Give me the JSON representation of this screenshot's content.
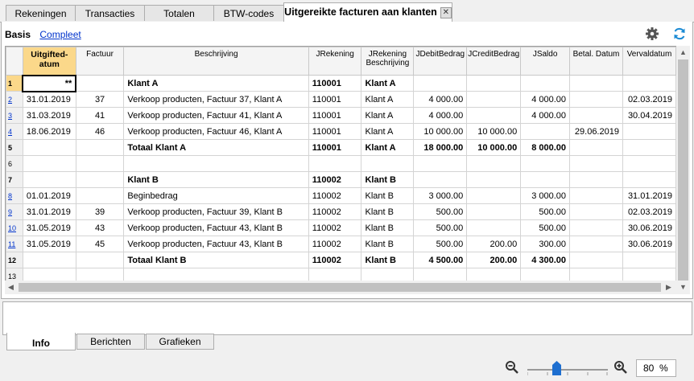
{
  "tabs": [
    {
      "label": "Rekeningen"
    },
    {
      "label": "Transacties"
    },
    {
      "label": "Totalen"
    },
    {
      "label": "BTW-codes"
    },
    {
      "label": "Uitgereikte facturen aan klanten"
    }
  ],
  "close_glyph": "✕",
  "views": {
    "basis": "Basis",
    "compleet": "Compleet"
  },
  "columns": {
    "date": "Uitgifted-atum",
    "factuur": "Factuur",
    "beschrijving": "Beschrijving",
    "jrekening": "JRekening",
    "jrekening_beschrijving": "JRekening Beschrijving",
    "jdebit": "JDebitBedrag",
    "jcredit": "JCreditBedrag",
    "jsaldo": "JSaldo",
    "betal_datum": "Betal. Datum",
    "vervaldatum": "Vervaldatum"
  },
  "rows": [
    {
      "n": "1",
      "date": "**",
      "factuur": "",
      "beschrijving": "Klant A",
      "jrekening": "110001",
      "jrekbeschr": "Klant A",
      "debit": "",
      "credit": "",
      "saldo": "",
      "betal": "",
      "verval": ""
    },
    {
      "n": "2",
      "date": "31.01.2019",
      "factuur": "37",
      "beschrijving": "Verkoop producten, Factuur 37, Klant A",
      "jrekening": "110001",
      "jrekbeschr": "Klant A",
      "debit": "4 000.00",
      "credit": "",
      "saldo": "4 000.00",
      "betal": "",
      "verval": "02.03.2019"
    },
    {
      "n": "3",
      "date": "31.03.2019",
      "factuur": "41",
      "beschrijving": "Verkoop producten, Factuur 41, Klant A",
      "jrekening": "110001",
      "jrekbeschr": "Klant A",
      "debit": "4 000.00",
      "credit": "",
      "saldo": "4 000.00",
      "betal": "",
      "verval": "30.04.2019"
    },
    {
      "n": "4",
      "date": "18.06.2019",
      "factuur": "46",
      "beschrijving": "Verkoop producten, Factuur 46, Klant A",
      "jrekening": "110001",
      "jrekbeschr": "Klant A",
      "debit": "10 000.00",
      "credit": "10 000.00",
      "saldo": "",
      "betal": "29.06.2019",
      "verval": ""
    },
    {
      "n": "5",
      "date": "",
      "factuur": "",
      "beschrijving": "Totaal Klant A",
      "jrekening": "110001",
      "jrekbeschr": "Klant A",
      "debit": "18 000.00",
      "credit": "10 000.00",
      "saldo": "8 000.00",
      "betal": "",
      "verval": ""
    },
    {
      "n": "6",
      "date": "",
      "factuur": "",
      "beschrijving": "",
      "jrekening": "",
      "jrekbeschr": "",
      "debit": "",
      "credit": "",
      "saldo": "",
      "betal": "",
      "verval": ""
    },
    {
      "n": "7",
      "date": "",
      "factuur": "",
      "beschrijving": "Klant B",
      "jrekening": "110002",
      "jrekbeschr": "Klant B",
      "debit": "",
      "credit": "",
      "saldo": "",
      "betal": "",
      "verval": ""
    },
    {
      "n": "8",
      "date": "01.01.2019",
      "factuur": "",
      "beschrijving": "Beginbedrag",
      "jrekening": "110002",
      "jrekbeschr": "Klant B",
      "debit": "3 000.00",
      "credit": "",
      "saldo": "3 000.00",
      "betal": "",
      "verval": "31.01.2019"
    },
    {
      "n": "9",
      "date": "31.01.2019",
      "factuur": "39",
      "beschrijving": "Verkoop producten, Factuur 39, Klant B",
      "jrekening": "110002",
      "jrekbeschr": "Klant B",
      "debit": "500.00",
      "credit": "",
      "saldo": "500.00",
      "betal": "",
      "verval": "02.03.2019"
    },
    {
      "n": "10",
      "date": "31.05.2019",
      "factuur": "43",
      "beschrijving": "Verkoop producten, Factuur 43, Klant B",
      "jrekening": "110002",
      "jrekbeschr": "Klant B",
      "debit": "500.00",
      "credit": "",
      "saldo": "500.00",
      "betal": "",
      "verval": "30.06.2019"
    },
    {
      "n": "11",
      "date": "31.05.2019",
      "factuur": "45",
      "beschrijving": "Verkoop producten, Factuur 43, Klant B",
      "jrekening": "110002",
      "jrekbeschr": "Klant B",
      "debit": "500.00",
      "credit": "200.00",
      "saldo": "300.00",
      "betal": "",
      "verval": "30.06.2019"
    },
    {
      "n": "12",
      "date": "",
      "factuur": "",
      "beschrijving": "Totaal Klant B",
      "jrekening": "110002",
      "jrekbeschr": "Klant B",
      "debit": "4 500.00",
      "credit": "200.00",
      "saldo": "4 300.00",
      "betal": "",
      "verval": ""
    },
    {
      "n": "13",
      "date": "",
      "factuur": "",
      "beschrijving": "",
      "jrekening": "",
      "jrekbeschr": "",
      "debit": "",
      "credit": "",
      "saldo": "",
      "betal": "",
      "verval": ""
    }
  ],
  "bottom_tabs": [
    {
      "label": "Info"
    },
    {
      "label": "Berichten"
    },
    {
      "label": "Grafieken"
    }
  ],
  "zoom": {
    "value": "80",
    "unit": "%",
    "level_percent": 80
  },
  "icons": {
    "settings": "gear-icon",
    "refresh": "refresh-icon",
    "zoom_out": "zoom-out-icon",
    "zoom_in": "zoom-in-icon"
  },
  "colors": {
    "selected_header": "#fbd88a",
    "link": "#0033cc",
    "refresh": "#1a8ad4"
  }
}
